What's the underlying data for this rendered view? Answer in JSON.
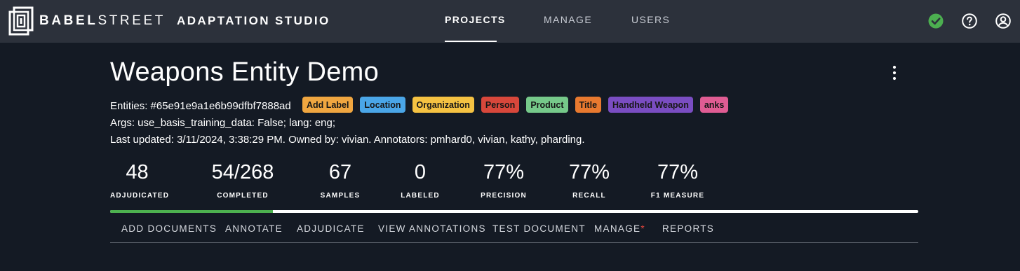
{
  "header": {
    "brand_bold": "BABEL",
    "brand_light": "STREET",
    "product": "ADAPTATION STUDIO",
    "nav": [
      {
        "label": "PROJECTS",
        "active": true
      },
      {
        "label": "MANAGE",
        "active": false
      },
      {
        "label": "USERS",
        "active": false
      }
    ],
    "icons": [
      "status-ok-icon",
      "help-icon",
      "account-icon"
    ],
    "status_color": "#4caf50"
  },
  "project": {
    "title": "Weapons Entity Demo",
    "entities_text": "Entities: #65e91e9a1e6b99dfbf7888ad",
    "tags": [
      {
        "label": "Add Label",
        "color": "#f0a640"
      },
      {
        "label": "Location",
        "color": "#4aa6e8"
      },
      {
        "label": "Organization",
        "color": "#f5c242"
      },
      {
        "label": "Person",
        "color": "#d8473b"
      },
      {
        "label": "Product",
        "color": "#76c98a"
      },
      {
        "label": "Title",
        "color": "#e8792f"
      },
      {
        "label": "Handheld Weapon",
        "color": "#7a4dc2"
      },
      {
        "label": "anks",
        "color": "#e05c93"
      }
    ],
    "args_text": "Args: use_basis_training_data: False; lang: eng;",
    "updated_text": "Last updated: 3/11/2024, 3:38:29 PM. Owned by: vivian. Annotators: pmhard0, vivian, kathy, pharding."
  },
  "stats": [
    {
      "value": "48",
      "label": "ADJUDICATED"
    },
    {
      "value": "54/268",
      "label": "COMPLETED"
    },
    {
      "value": "67",
      "label": "SAMPLES"
    },
    {
      "value": "0",
      "label": "LABELED"
    },
    {
      "value": "77%",
      "label": "PRECISION"
    },
    {
      "value": "77%",
      "label": "RECALL"
    },
    {
      "value": "77%",
      "label": "F1 MEASURE"
    }
  ],
  "progress": {
    "completed": 54,
    "total": 268,
    "fraction": 0.2015,
    "color": "#4db14f"
  },
  "actions": [
    {
      "label": "ADD DOCUMENTS",
      "marked": false
    },
    {
      "label": "ANNOTATE",
      "marked": false
    },
    {
      "label": "ADJUDICATE",
      "marked": false
    },
    {
      "label": "VIEW ANNOTATIONS",
      "marked": false
    },
    {
      "label": "TEST DOCUMENT",
      "marked": false
    },
    {
      "label": "MANAGE",
      "marked": true,
      "mark": "*"
    },
    {
      "label": "REPORTS",
      "marked": false
    }
  ]
}
